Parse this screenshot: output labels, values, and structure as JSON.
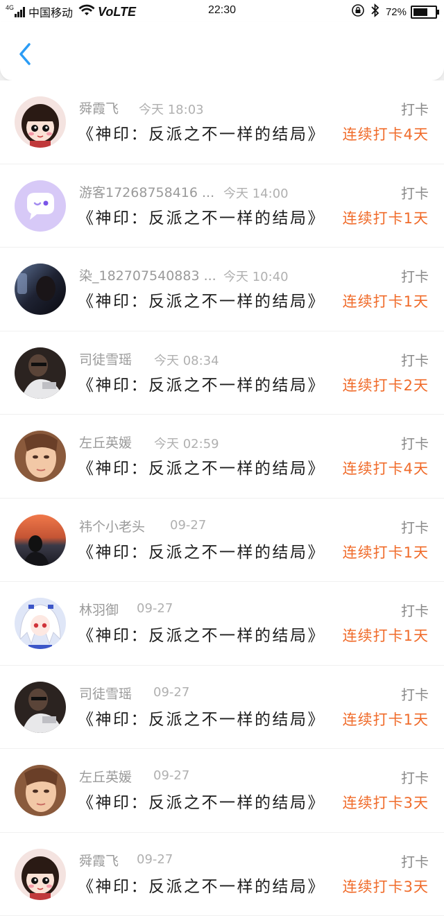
{
  "status_bar": {
    "network_type": "4G",
    "carrier": "中国移动",
    "volte": "VoLTE",
    "time": "22:30",
    "battery": "72%",
    "battery_level": 0.72
  },
  "nav": {
    "back_icon": "chevron-left-icon",
    "accent_color": "#2b9cf5"
  },
  "colors": {
    "streak": "#f06b2a",
    "name": "#9a9a9a"
  },
  "records": [
    {
      "name": "舜霞飞",
      "time": "今天 18:03",
      "type": "打卡",
      "book": "《神印：反派之不一样的结局》",
      "streak": "连续打卡4天",
      "avatar": "cartoon-girl-avatar"
    },
    {
      "name": "游客17268758416 ...",
      "time": "今天 14:00",
      "type": "打卡",
      "book": "《神印：反派之不一样的结局》",
      "streak": "连续打卡1天",
      "avatar": "default-chat-avatar"
    },
    {
      "name": "染_182707540883 ...",
      "time": "今天 10:40",
      "type": "打卡",
      "book": "《神印：反派之不一样的结局》",
      "streak": "连续打卡1天",
      "avatar": "dark-photo-avatar"
    },
    {
      "name": "司徒雪瑶",
      "time": "今天 08:34",
      "type": "打卡",
      "book": "《神印：反派之不一样的结局》",
      "streak": "连续打卡2天",
      "avatar": "photo-avatar"
    },
    {
      "name": "左丘英媛",
      "time": "今天 02:59",
      "type": "打卡",
      "book": "《神印：反派之不一样的结局》",
      "streak": "连续打卡4天",
      "avatar": "face-photo-avatar"
    },
    {
      "name": "祎个小老头",
      "time": "09-27",
      "type": "打卡",
      "book": "《神印：反派之不一样的结局》",
      "streak": "连续打卡1天",
      "avatar": "sunset-photo-avatar"
    },
    {
      "name": "林羽御",
      "time": "09-27",
      "type": "打卡",
      "book": "《神印：反派之不一样的结局》",
      "streak": "连续打卡1天",
      "avatar": "anime-avatar"
    },
    {
      "name": "司徒雪瑶",
      "time": "09-27",
      "type": "打卡",
      "book": "《神印：反派之不一样的结局》",
      "streak": "连续打卡1天",
      "avatar": "photo-avatar"
    },
    {
      "name": "左丘英媛",
      "time": "09-27",
      "type": "打卡",
      "book": "《神印：反派之不一样的结局》",
      "streak": "连续打卡3天",
      "avatar": "face-photo-avatar"
    },
    {
      "name": "舜霞飞",
      "time": "09-27",
      "type": "打卡",
      "book": "《神印：反派之不一样的结局》",
      "streak": "连续打卡3天",
      "avatar": "cartoon-girl-avatar"
    }
  ]
}
